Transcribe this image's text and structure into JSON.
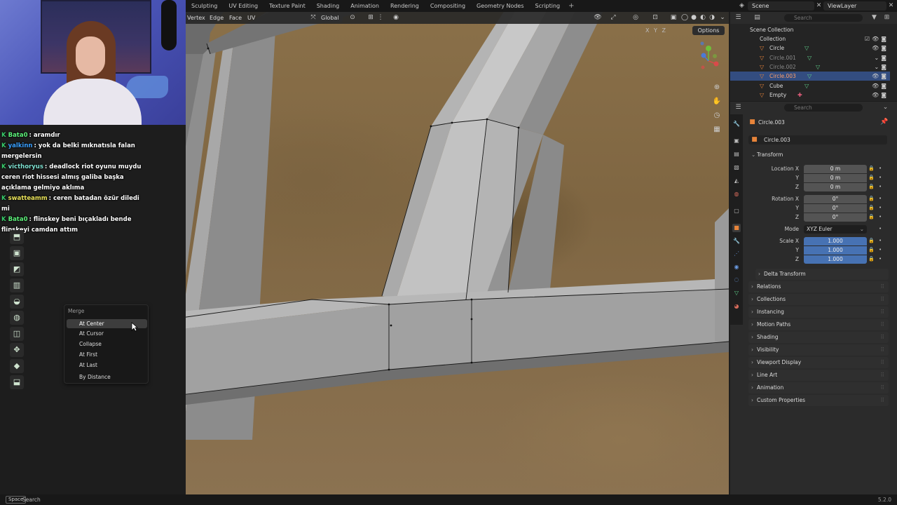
{
  "workspace_tabs": [
    "Sculpting",
    "UV Editing",
    "Texture Paint",
    "Shading",
    "Animation",
    "Rendering",
    "Compositing",
    "Geometry Nodes",
    "Scripting"
  ],
  "scene": "Scene",
  "view_layer": "ViewLayer",
  "outliner_search_placeholder": "Search",
  "props_search_placeholder": "Search",
  "viewport_header": {
    "select_modes": [
      "Vertex",
      "Edge",
      "Face",
      "UV"
    ],
    "transform_orientation": "Global",
    "options_label": "Options",
    "axis_toggles": "X Y Z"
  },
  "chat": [
    {
      "user": "Bata0",
      "text": ": aramdır",
      "color": "#5cf07a"
    },
    {
      "user": "yalkinn",
      "text": ": yok da belki mıknatısla falan mergelersin",
      "color": "#3aa0ff"
    },
    {
      "user": "victhoryus",
      "text": ": deadlock riot oyunu muydu ceren riot hissesi almış galiba başka açıklama gelmiyo aklıma",
      "color": "#7ee0d0"
    },
    {
      "user": "swatteamm",
      "text": ": ceren batadan özür diledi mi",
      "color": "#e9e25a"
    },
    {
      "user": "Bata0",
      "text": ": flinskey beni bıçakladı bende flinskeyi camdan attım",
      "color": "#5cf07a"
    }
  ],
  "merge_menu": {
    "title": "Merge",
    "items": [
      "At Center",
      "At Cursor",
      "Collapse",
      "At First",
      "At Last",
      "By Distance"
    ],
    "active_index": 0
  },
  "outliner": {
    "root": "Scene Collection",
    "collection": "Collection",
    "objects": [
      "Circle",
      "Circle.001",
      "Circle.002",
      "Circle.003",
      "Cube",
      "Empty"
    ],
    "selected": "Circle.003"
  },
  "properties": {
    "object_name_header": "Circle.003",
    "object_name_field": "Circle.003",
    "transform_title": "Transform",
    "location_label": "Location X",
    "rotation_label": "Rotation X",
    "scale_label": "Scale X",
    "axis_y": "Y",
    "axis_z": "Z",
    "location": [
      "0 m",
      "0 m",
      "0 m"
    ],
    "rotation": [
      "0°",
      "0°",
      "0°"
    ],
    "mode_label": "Mode",
    "mode_value": "XYZ Euler",
    "scale": [
      "1.000",
      "1.000",
      "1.000"
    ],
    "delta_transform": "Delta Transform",
    "sections": [
      "Relations",
      "Collections",
      "Instancing",
      "Motion Paths",
      "Shading",
      "Visibility",
      "Viewport Display",
      "Line Art",
      "Animation",
      "Custom Properties"
    ]
  },
  "statusbar": {
    "key": "Space",
    "action": "Search",
    "version": "5.2.0"
  }
}
